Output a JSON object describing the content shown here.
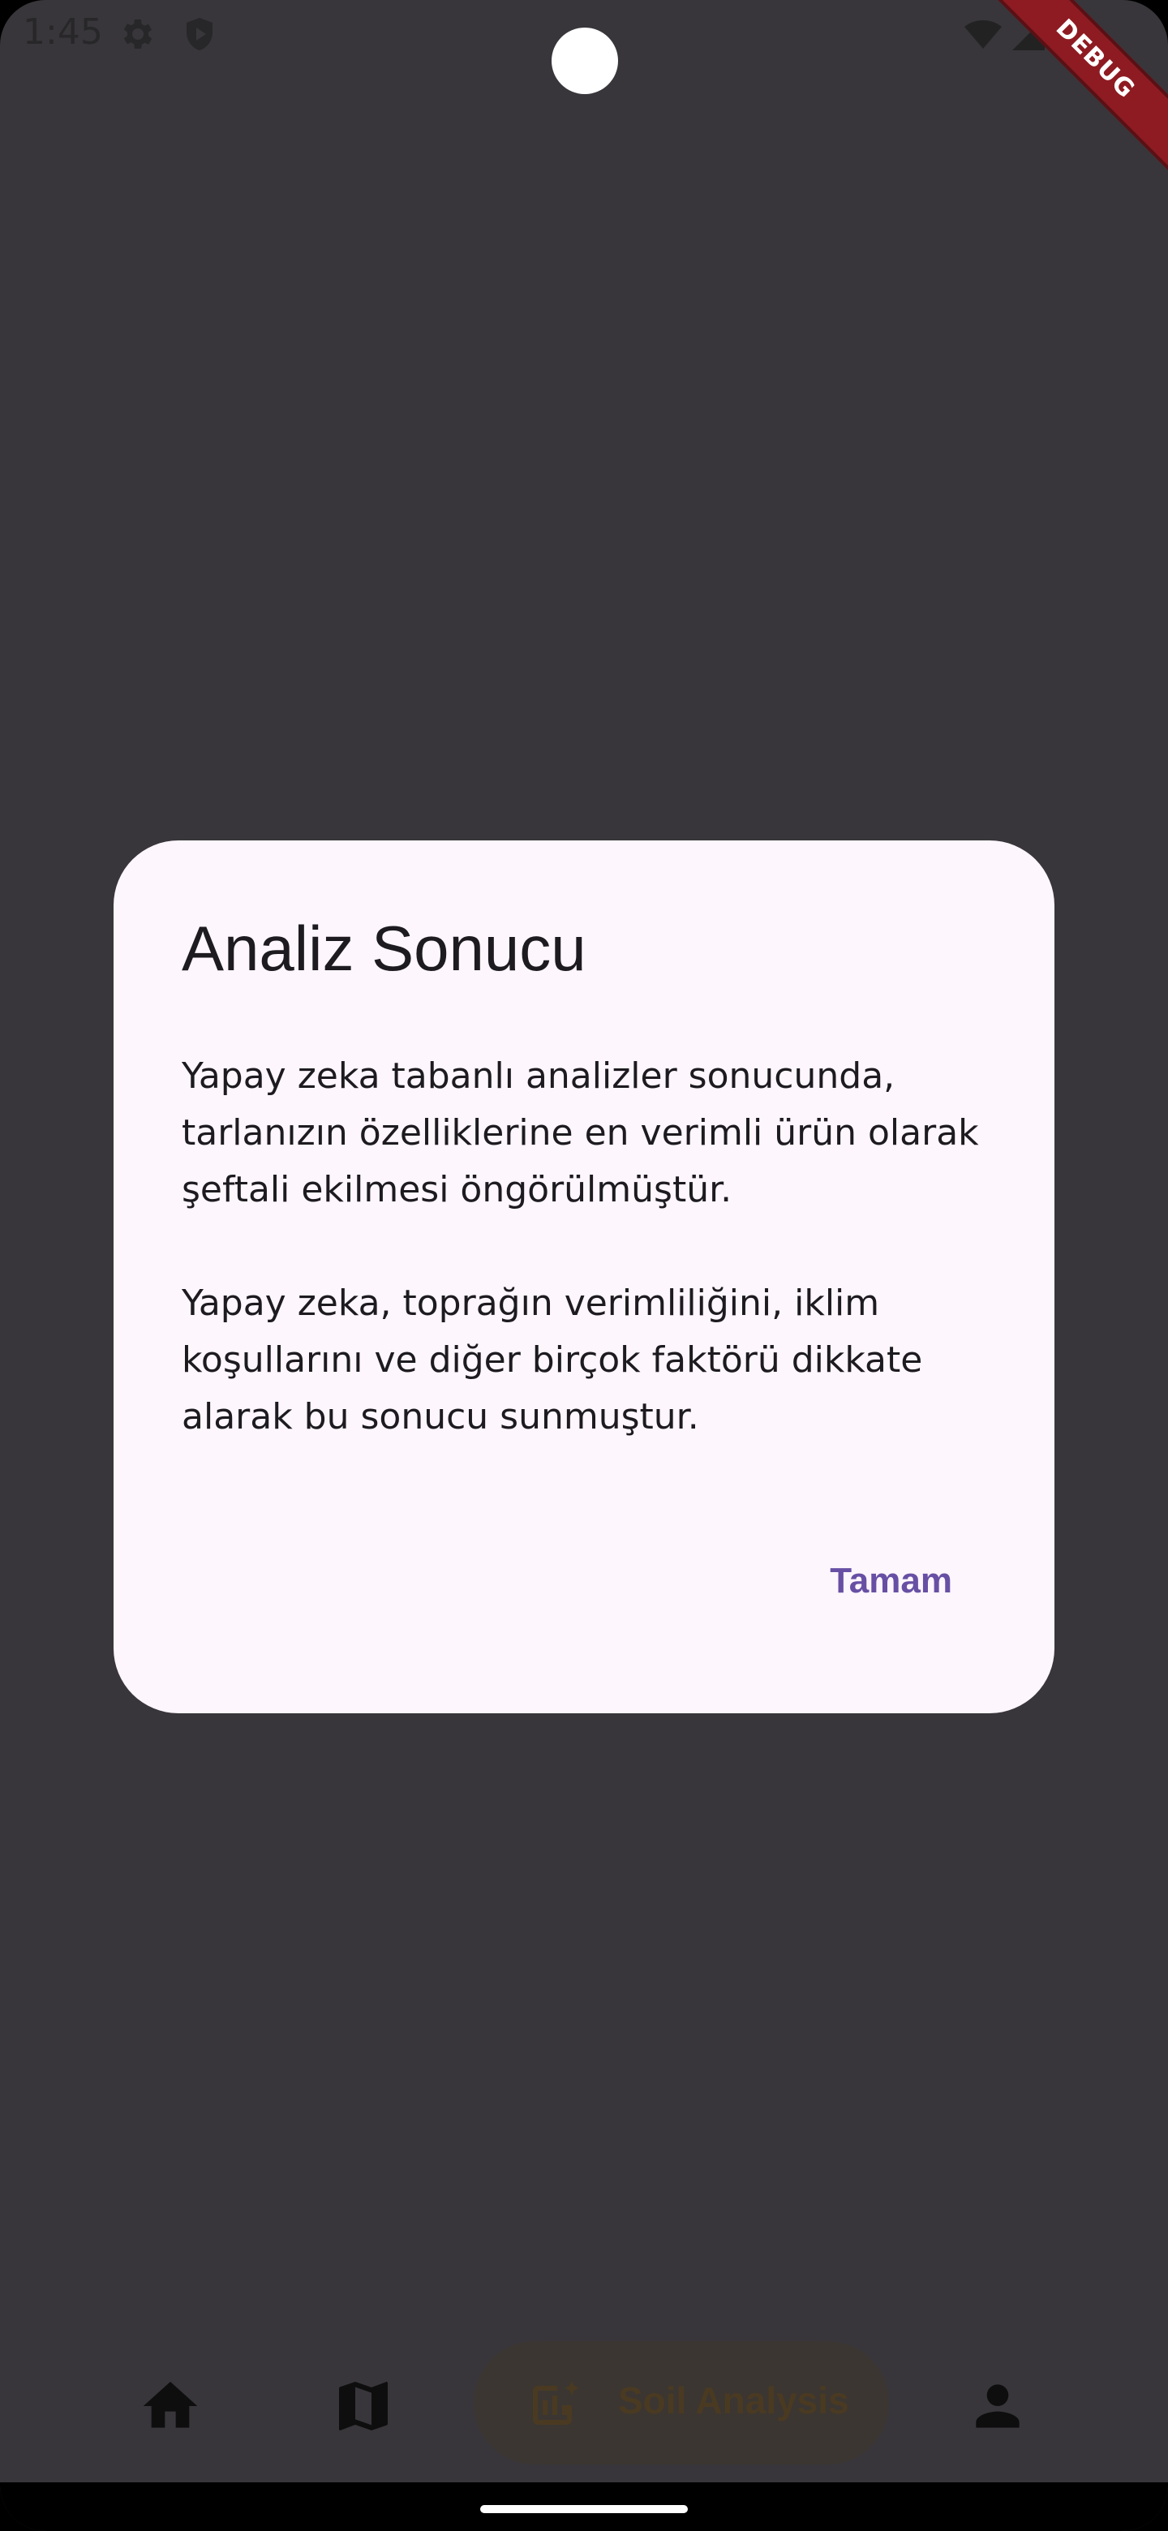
{
  "status_bar": {
    "time": "1:45",
    "icons": [
      "gear-icon",
      "shield-play-icon",
      "wifi-icon",
      "signal-icon",
      "battery-icon"
    ]
  },
  "debug_banner": {
    "label": "DEBUG",
    "color": "#8E1B22"
  },
  "dialog": {
    "title": "Analiz Sonucu",
    "paragraphs": [
      "Yapay zeka tabanlı analizler sonucunda, tarlanızın özelliklerine en verimli ürün olarak şeftali ekilmesi öngörülmüştür.",
      "Yapay zeka, toprağın verimliliğini, iklim koşullarını ve diğer birçok faktörü dikkate alarak bu sonucu sunmuştur."
    ],
    "ok_label": "Tamam",
    "background": "#FDF6FC",
    "accent": "#6750A4"
  },
  "bottom_nav": {
    "items": [
      {
        "icon": "home-icon",
        "label": ""
      },
      {
        "icon": "map-icon",
        "label": ""
      },
      {
        "icon": "soil-analysis-icon",
        "label": "Soil Analysis",
        "selected": true
      },
      {
        "icon": "person-icon",
        "label": ""
      }
    ]
  }
}
